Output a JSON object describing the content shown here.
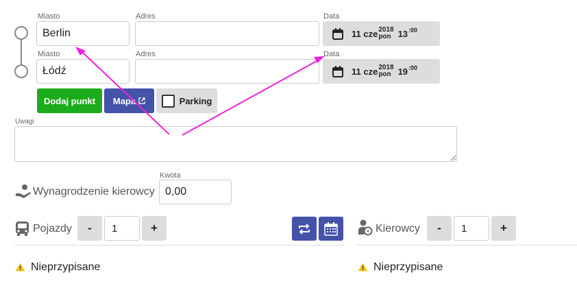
{
  "route": {
    "points": [
      {
        "city_label": "Miasto",
        "city_value": "Berlin",
        "address_label": "Adres",
        "address_value": "",
        "date_label": "Data",
        "day": "11 cze",
        "year": "2018",
        "weekday": "pon",
        "hour": "13",
        "minute": ":00"
      },
      {
        "city_label": "Miasto",
        "city_value": "Łódź",
        "address_label": "Adres",
        "address_value": "",
        "date_label": "Data",
        "day": "11 cze",
        "year": "2018",
        "weekday": "pon",
        "hour": "19",
        "minute": ":00"
      }
    ],
    "add_point_label": "Dodaj punkt",
    "map_label": "Mapa",
    "parking_label": "Parking"
  },
  "notes": {
    "label": "Uwagi",
    "value": ""
  },
  "driver_pay": {
    "title": "Wynagrodzenie kierowcy",
    "amount_label": "Kwota",
    "amount_value": "0,00"
  },
  "vehicles": {
    "title": "Pojazdy",
    "minus": "-",
    "count": "1",
    "plus": "+",
    "status": "Nieprzypisane"
  },
  "drivers": {
    "title": "Kierowcy",
    "minus": "-",
    "count": "1",
    "plus": "+",
    "status": "Nieprzypisane"
  },
  "colors": {
    "green": "#1aac1a",
    "blue": "#4452a8",
    "annotation": "#ee22dd",
    "warning": "#f5c518"
  },
  "icons": [
    "calendar-icon",
    "external-link-icon",
    "hand-money-icon",
    "bus-icon",
    "swap-icon",
    "calendar-grid-icon",
    "driver-icon",
    "warning-icon"
  ]
}
